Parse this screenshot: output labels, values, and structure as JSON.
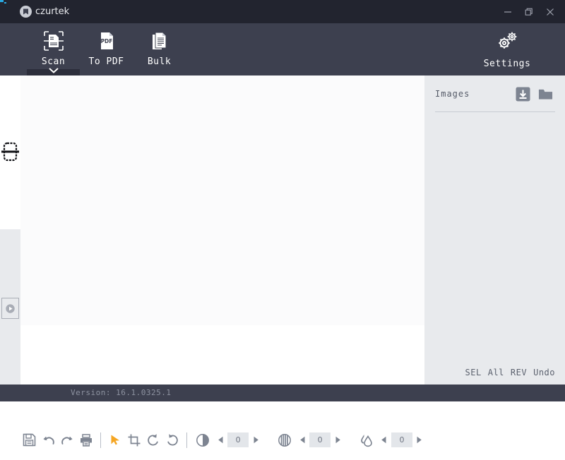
{
  "window": {
    "app_name": "czurtek",
    "logo_icon": "czur-circle-logo-icon",
    "minimize_label": "minimize-icon",
    "restore_label": "restore-icon",
    "close_label": "close-icon"
  },
  "ribbon": {
    "tabs": [
      {
        "label": "Scan",
        "icon": "scan-document-icon",
        "active": true
      },
      {
        "label": "To PDF",
        "icon": "pdf-document-icon",
        "active": false
      },
      {
        "label": "Bulk",
        "icon": "bulk-documents-icon",
        "active": false
      }
    ],
    "settings": {
      "label": "Settings",
      "icon": "gears-icon"
    }
  },
  "left_rail": {
    "scan_frame_icon": "scan-frame-icon",
    "play_button_icon": "play-icon"
  },
  "toolbar": {
    "buttons": [
      {
        "name": "save-button",
        "icon": "floppy-disk-icon"
      },
      {
        "name": "undo-button",
        "icon": "undo-arrow-icon"
      },
      {
        "name": "redo-button",
        "icon": "redo-arrow-icon"
      },
      {
        "name": "print-button",
        "icon": "printer-icon"
      },
      {
        "name": "pointer-button",
        "icon": "cursor-arrow-icon",
        "active": true
      },
      {
        "name": "crop-button",
        "icon": "crop-icon"
      },
      {
        "name": "rotate-left-button",
        "icon": "rotate-left-icon"
      },
      {
        "name": "rotate-right-button",
        "icon": "rotate-right-icon"
      }
    ],
    "adjustments": [
      {
        "name": "brightness",
        "icon": "brightness-icon",
        "value": "0"
      },
      {
        "name": "contrast",
        "icon": "contrast-icon",
        "value": "0"
      },
      {
        "name": "saturation",
        "icon": "water-drop-icon",
        "value": "0"
      }
    ],
    "decrease_icon": "triangle-left-icon",
    "increase_icon": "triangle-right-icon"
  },
  "right_panel": {
    "title": "Images",
    "import_icon": "download-import-icon",
    "folder_icon": "folder-icon",
    "footer_buttons": [
      {
        "label": "SEL"
      },
      {
        "label": "All"
      },
      {
        "label": "REV"
      },
      {
        "label": "Undo"
      }
    ]
  },
  "status_bar": {
    "version": "Version: 16.1.0325.1"
  },
  "colors": {
    "titlebar": "#22242f",
    "ribbon": "#3d404f",
    "accent_orange": "#f5a623",
    "panel_gray": "#e8eaed",
    "icon_gray": "#7d8491",
    "logo_blue": "#29a8e0"
  }
}
